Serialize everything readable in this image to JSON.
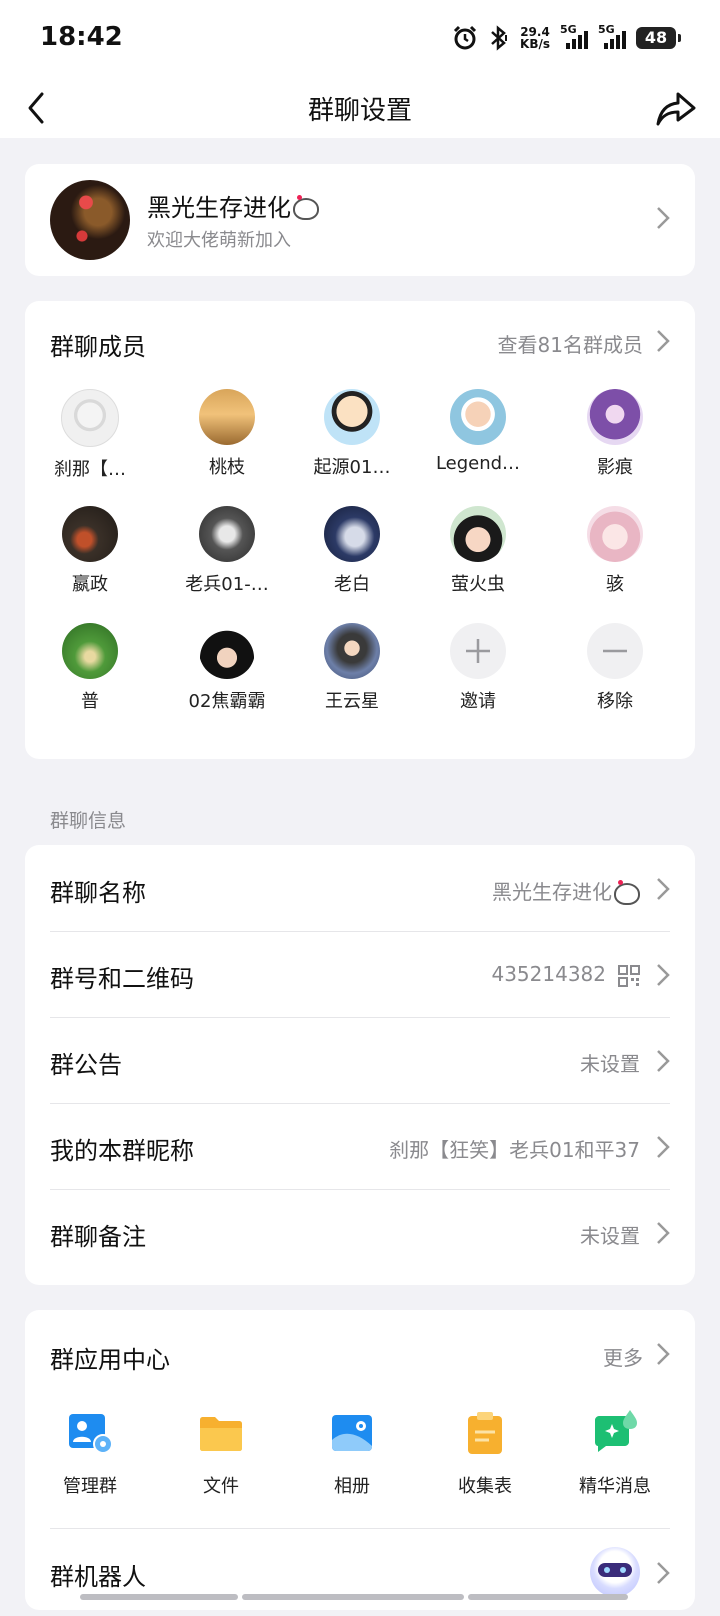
{
  "status_bar": {
    "time": "18:42",
    "speed_value": "29.4",
    "speed_unit": "KB/s",
    "sim1": "5G",
    "sim2": "5G",
    "battery": "48",
    "icons": [
      "alarm-icon",
      "bluetooth-icon",
      "signal-icon",
      "battery-icon"
    ]
  },
  "nav": {
    "title": "群聊设置",
    "back_icon": "chevron-left-icon",
    "share_icon": "share-icon"
  },
  "group": {
    "name": "黑光生存进化",
    "description": "欢迎大佬萌新加入"
  },
  "members": {
    "title": "群聊成员",
    "view_all": "查看81名群成员",
    "list": [
      {
        "name": "刹那【…"
      },
      {
        "name": "桃枝"
      },
      {
        "name": "起源01…"
      },
      {
        "name": "Legend…"
      },
      {
        "name": "影痕"
      },
      {
        "name": "嬴政"
      },
      {
        "name": "老兵01-…"
      },
      {
        "name": "老白"
      },
      {
        "name": "萤火虫"
      },
      {
        "name": "骇"
      },
      {
        "name": "普"
      },
      {
        "name": "02焦霸霸"
      },
      {
        "name": "王云星"
      }
    ],
    "invite_label": "邀请",
    "remove_label": "移除"
  },
  "info": {
    "section_label": "群聊信息",
    "rows": [
      {
        "label": "群聊名称",
        "value": "黑光生存进化"
      },
      {
        "label": "群号和二维码",
        "value": "435214382"
      },
      {
        "label": "群公告",
        "value": "未设置"
      },
      {
        "label": "我的本群昵称",
        "value": "刹那【狂笑】老兵01和平37"
      },
      {
        "label": "群聊备注",
        "value": "未设置"
      }
    ]
  },
  "apps": {
    "title": "群应用中心",
    "more": "更多",
    "items": [
      {
        "label": "管理群",
        "icon": "manage-group-icon"
      },
      {
        "label": "文件",
        "icon": "folder-icon"
      },
      {
        "label": "相册",
        "icon": "album-icon"
      },
      {
        "label": "收集表",
        "icon": "clipboard-icon"
      },
      {
        "label": "精华消息",
        "icon": "essence-message-icon"
      }
    ],
    "robot_label": "群机器人"
  },
  "colors": {
    "background": "#F2F2F6",
    "card": "#FFFFFF",
    "secondary_text": "#8A8A8E",
    "accent_blue": "#1E8CF0",
    "accent_orange": "#F7B02F",
    "accent_green": "#1DBF73"
  }
}
